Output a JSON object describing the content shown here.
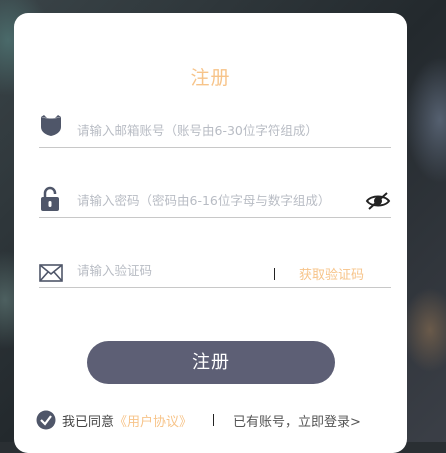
{
  "form": {
    "title": "注册",
    "email": {
      "placeholder": "请输入邮箱账号（账号由6-30位字符组成）",
      "icon": "user-shield-icon"
    },
    "password": {
      "placeholder": "请输入密码（密码由6-16位字母与数字组成）",
      "icon": "unlock-icon",
      "toggle_icon": "eye-hidden-icon"
    },
    "code": {
      "placeholder": "请输入验证码",
      "icon": "envelope-icon",
      "button_label": "获取验证码"
    },
    "submit_label": "注册",
    "agreement": {
      "prefix": "我已同意",
      "link": "《用户协议》",
      "icon": "check-circle-icon"
    },
    "login_link": "已有账号，立即登录>"
  },
  "colors": {
    "accent": "#f7c48a",
    "button": "#5d5f75",
    "icon": "#4f5669"
  }
}
